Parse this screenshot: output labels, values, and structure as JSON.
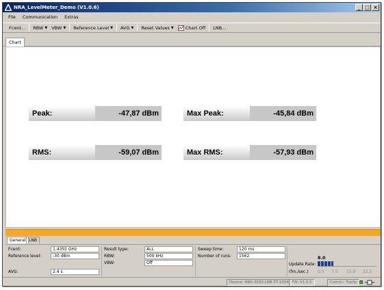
{
  "window": {
    "title": "NRA_LevelMeter_Demo (V1.0.6)",
    "minimize": "_",
    "maximize": "□",
    "close": "×"
  },
  "menu": [
    "File",
    "Communication",
    "Extras"
  ],
  "toolbar": {
    "fcent": "Fcent...",
    "rbw": "RBW",
    "vbw": "VBW",
    "ref_level": "Reference Level",
    "avg": "AVG",
    "reset_values": "Reset Values",
    "chart_off": "Chart Off",
    "lnb": "LNB..."
  },
  "top_tab": "Chart",
  "measurements": {
    "peak": {
      "label": "Peak:",
      "value": "-47,87 dBm"
    },
    "max_peak": {
      "label": "Max Peak:",
      "value": "-45,84 dBm"
    },
    "rms": {
      "label": "RMS:",
      "value": "-59,07 dBm"
    },
    "max_rms": {
      "label": "Max RMS:",
      "value": "-57,93 dBm"
    }
  },
  "bottom_tabs": [
    "General",
    "LNB"
  ],
  "general": {
    "fcent_label": "Fcent:",
    "fcent_value": "1.4355 GHz",
    "ref_label": "Reference level:",
    "ref_value": "-30 dBm",
    "avg_label": "AVG:",
    "avg_value": "2.4 s",
    "result_label": "Result type:",
    "result_value": "ALL",
    "rbw_label": "RBW:",
    "rbw_value": "500 kHz",
    "vbw_label": "VBW:",
    "vbw_value": "Off",
    "sweep_label": "Sweep time:",
    "sweep_value": "120 ms",
    "runs_label": "Number of runs:",
    "runs_value": "1562",
    "update_label": "Update Rate:",
    "update_unit": "(fm./sec.)",
    "update_value": "8.0",
    "update_ticks": [
      "0.0",
      "7.5",
      "15.0",
      "22.5"
    ],
    "update_level": 0.27
  },
  "status": {
    "device": "Device: NRA-3000-LNB PT-1004",
    "fw": "FW: V1.0.5",
    "comm": "Comm.: Tcp/Ip"
  },
  "colors": {
    "orange_bar": "#f5a623",
    "title_bar": "#0a246a",
    "update_bar": "#1f3f8f",
    "status_led": "#3cb043"
  }
}
